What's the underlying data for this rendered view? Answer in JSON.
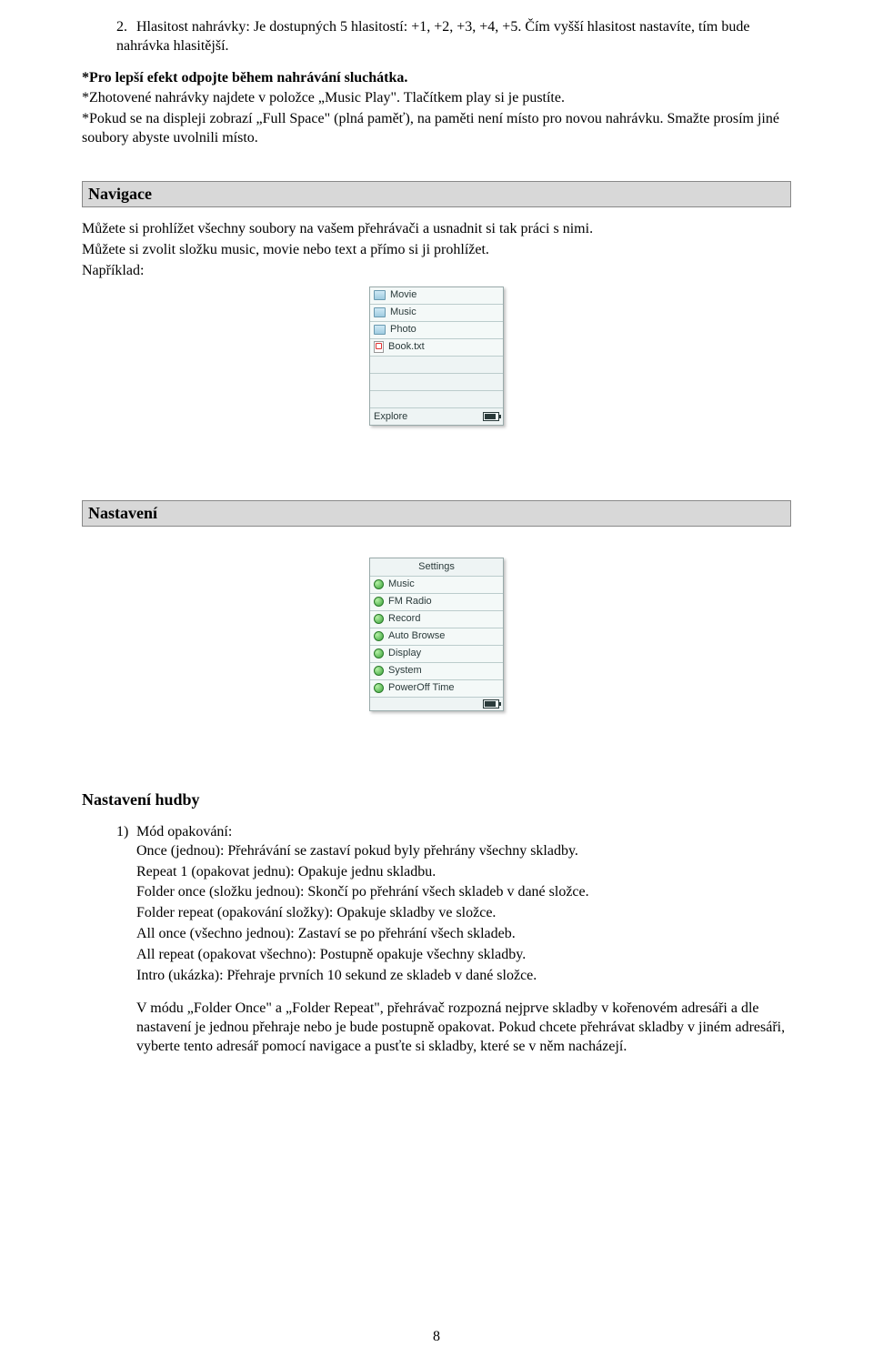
{
  "top": {
    "item_no": "2.",
    "item_text": "Hlasitost nahrávky: Je dostupných 5 hlasitostí: +1, +2, +3, +4, +5. Čím vyšší hlasitost nastavíte, tím bude nahrávka hlasitější.",
    "note1": "*Pro lepší efekt odpojte během nahrávání sluchátka.",
    "note2": "*Zhotovené nahrávky najdete v položce „Music Play\". Tlačítkem play si je pustíte.",
    "note3": "*Pokud se na displeji zobrazí „Full Space\" (plná paměť), na paměti není místo pro novou nahrávku. Smažte prosím jiné soubory abyste uvolnili místo."
  },
  "navigace": {
    "heading": "Navigace",
    "p1": "Můžete si prohlížet všechny soubory na vašem přehrávači a usnadnit si tak práci s nimi.",
    "p2": "Můžete si zvolit složku music, movie nebo text a přímo si ji prohlížet.",
    "p3": "Například:",
    "shot": {
      "items": [
        "Movie",
        "Music",
        "Photo",
        "Book.txt"
      ],
      "footer": "Explore"
    }
  },
  "nastaveni": {
    "heading": "Nastavení",
    "shot": {
      "title": "Settings",
      "items": [
        "Music",
        "FM Radio",
        "Record",
        "Auto Browse",
        "Display",
        "System",
        "PowerOff Time"
      ]
    }
  },
  "hudby": {
    "heading": "Nastavení hudby",
    "item_no": "1)",
    "item_label": "Mód opakování:",
    "lines": [
      "Once (jednou): Přehrávání se zastaví pokud byly přehrány všechny skladby.",
      "Repeat 1 (opakovat jednu): Opakuje jednu skladbu.",
      "Folder once (složku jednou): Skončí po přehrání všech skladeb v dané složce.",
      "Folder repeat (opakování složky): Opakuje skladby ve složce.",
      "All once (všechno jednou): Zastaví se po přehrání všech skladeb.",
      "All repeat (opakovat všechno): Postupně opakuje všechny skladby.",
      "Intro (ukázka): Přehraje prvních 10 sekund ze skladeb v dané složce."
    ],
    "folder_note": "V módu „Folder Once\" a „Folder Repeat\", přehrávač rozpozná nejprve skladby v kořenovém adresáři a dle nastavení je jednou přehraje nebo je bude postupně opakovat. Pokud chcete přehrávat skladby v jiném adresáři, vyberte tento adresář pomocí navigace a pusťte si skladby, které se v něm nacházejí."
  },
  "page_number": "8"
}
